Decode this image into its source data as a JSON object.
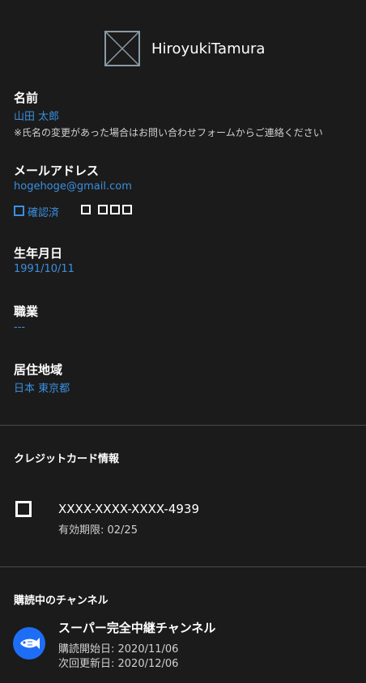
{
  "profile": {
    "username": "HiroyukiTamura",
    "avatar_icon": "image-placeholder-icon"
  },
  "fields": {
    "name": {
      "label": "名前",
      "value": "山田 太郎",
      "note": "※氏名の変更があった場合はお問い合わせフォームからご連絡ください"
    },
    "email": {
      "label": "メールアドレス",
      "value": "hogehoge@gmail.com",
      "verified_label": "確認済"
    },
    "birthday": {
      "label": "生年月日",
      "value": "1991/10/11"
    },
    "occupation": {
      "label": "職業",
      "value": "---"
    },
    "region": {
      "label": "居住地域",
      "value": "日本 東京都"
    }
  },
  "credit_card": {
    "section_title": "クレジットカード情報",
    "number": "XXXX-XXXX-XXXX-4939",
    "expiry": "有効期限: 02/25",
    "icon": "card-icon"
  },
  "subscriptions": {
    "section_title": "購読中のチャンネル",
    "channels": [
      {
        "name": "スーパー完全中継チャンネル",
        "start": "購読開始日: 2020/11/06",
        "renew": "次回更新日: 2020/12/06",
        "icon": "fish-icon"
      }
    ]
  },
  "colors": {
    "background": "#1b1b1b",
    "accent": "#3a8fe0",
    "channel_badge": "#1e6ef5",
    "divider": "#4a4a4a"
  }
}
